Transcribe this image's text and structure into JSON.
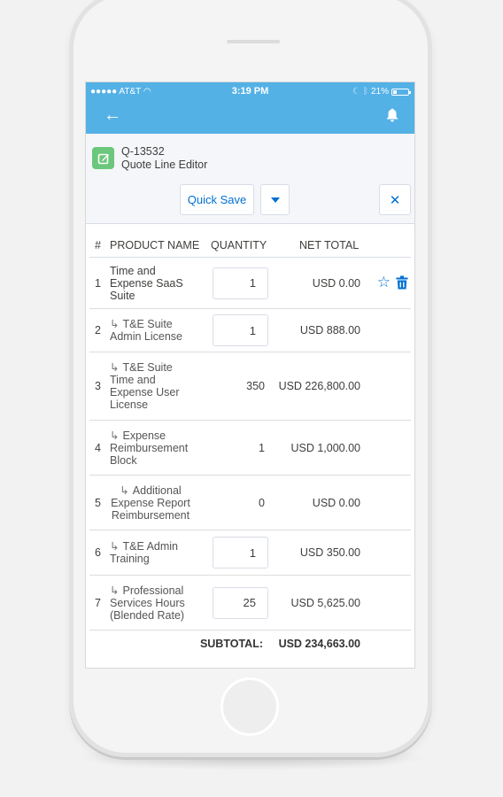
{
  "status_bar": {
    "carrier": "●●●●● AT&T",
    "wifi_icon": "wifi-icon",
    "time": "3:19 PM",
    "moon_icon": "moon-icon",
    "bluetooth_icon": "bluetooth-icon",
    "battery": "21%"
  },
  "nav": {
    "back_icon": "←",
    "bell_icon": "bell-icon"
  },
  "header": {
    "record_icon": "edit-icon",
    "record_id": "Q-13532",
    "title": "Quote Line Editor",
    "quick_save_label": "Quick Save",
    "dropdown_icon": "caret-down-icon",
    "close_label": "✕"
  },
  "table": {
    "columns": [
      "#",
      "PRODUCT NAME",
      "QUANTITY",
      "NET TOTAL"
    ],
    "rows": [
      {
        "num": "1",
        "name": "Time and Expense SaaS Suite",
        "child": false,
        "quantity": "1",
        "editable": true,
        "total": "USD 0.00",
        "actions": true
      },
      {
        "num": "2",
        "name": "T&E Suite Admin License",
        "child": true,
        "quantity": "1",
        "editable": true,
        "total": "USD 888.00",
        "actions": false
      },
      {
        "num": "3",
        "name": "T&E Suite Time and Expense User License",
        "child": true,
        "quantity": "350",
        "editable": false,
        "total": "USD 226,800.00",
        "actions": false
      },
      {
        "num": "4",
        "name": "Expense Reimbursement Block",
        "child": true,
        "quantity": "1",
        "editable": false,
        "total": "USD 1,000.00",
        "actions": false
      },
      {
        "num": "5",
        "name": "Additional Expense Report Reimbursement",
        "child": true,
        "quantity": "0",
        "editable": false,
        "total": "USD 0.00",
        "actions": false
      },
      {
        "num": "6",
        "name": "T&E Admin Training",
        "child": true,
        "quantity": "1",
        "editable": true,
        "total": "USD 350.00",
        "actions": false
      },
      {
        "num": "7",
        "name": "Professional Services Hours (Blended Rate)",
        "child": true,
        "quantity": "25",
        "editable": true,
        "total": "USD 5,625.00",
        "actions": false
      }
    ],
    "child_arrow": "↳",
    "subtotal_label": "SUBTOTAL:",
    "subtotal_value": "USD 234,663.00"
  },
  "colors": {
    "brand_blue": "#54b1e6",
    "link_blue": "#0070d2",
    "record_green": "#6bc77b"
  }
}
